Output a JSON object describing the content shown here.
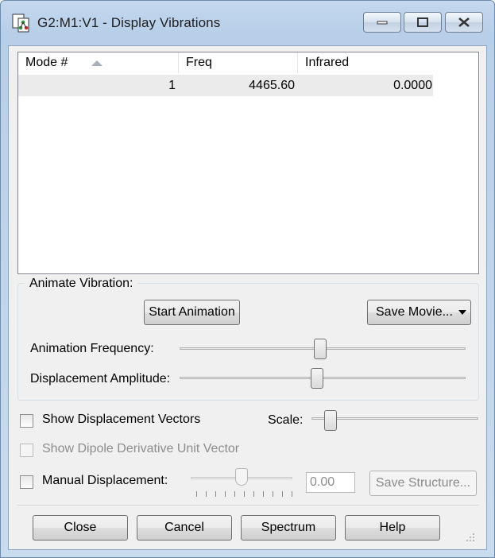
{
  "window": {
    "title": "G2:M1:V1 - Display Vibrations",
    "icon": "molecule-app-icon",
    "controls": [
      "minimize-icon",
      "maximize-icon",
      "close-icon"
    ]
  },
  "modes_table": {
    "columns": [
      "Mode #",
      "Freq",
      "Infrared"
    ],
    "sort_column": "Mode #",
    "sort_direction": "ascending",
    "rows": [
      [
        "1",
        "4465.60",
        "0.0000"
      ]
    ]
  },
  "animate_group": {
    "label": "Animate Vibration:",
    "start_button": "Start Animation",
    "save_movie_button": "Save Movie...",
    "frequency_label": "Animation Frequency:",
    "frequency_level": 0.49,
    "amplitude_label": "Displacement Amplitude:",
    "amplitude_level": 0.48
  },
  "options": {
    "show_vectors_label": "Show Displacement Vectors",
    "show_vectors_checked": false,
    "scale_label": "Scale:",
    "scale_level": 0.08,
    "dipole_label": "Show Dipole Derivative Unit Vector",
    "dipole_enabled": false,
    "manual_label": "Manual Displacement:",
    "manual_checked": false,
    "manual_level": 0.5,
    "manual_value": "0.00",
    "save_structure_button": "Save Structure..."
  },
  "footer": {
    "close": "Close",
    "cancel": "Cancel",
    "spectrum": "Spectrum",
    "help": "Help"
  },
  "colors": {
    "title_bar": "#b8cfe9",
    "dialog_background": "#f0f0f0",
    "selected_row": "#ebebeb"
  }
}
